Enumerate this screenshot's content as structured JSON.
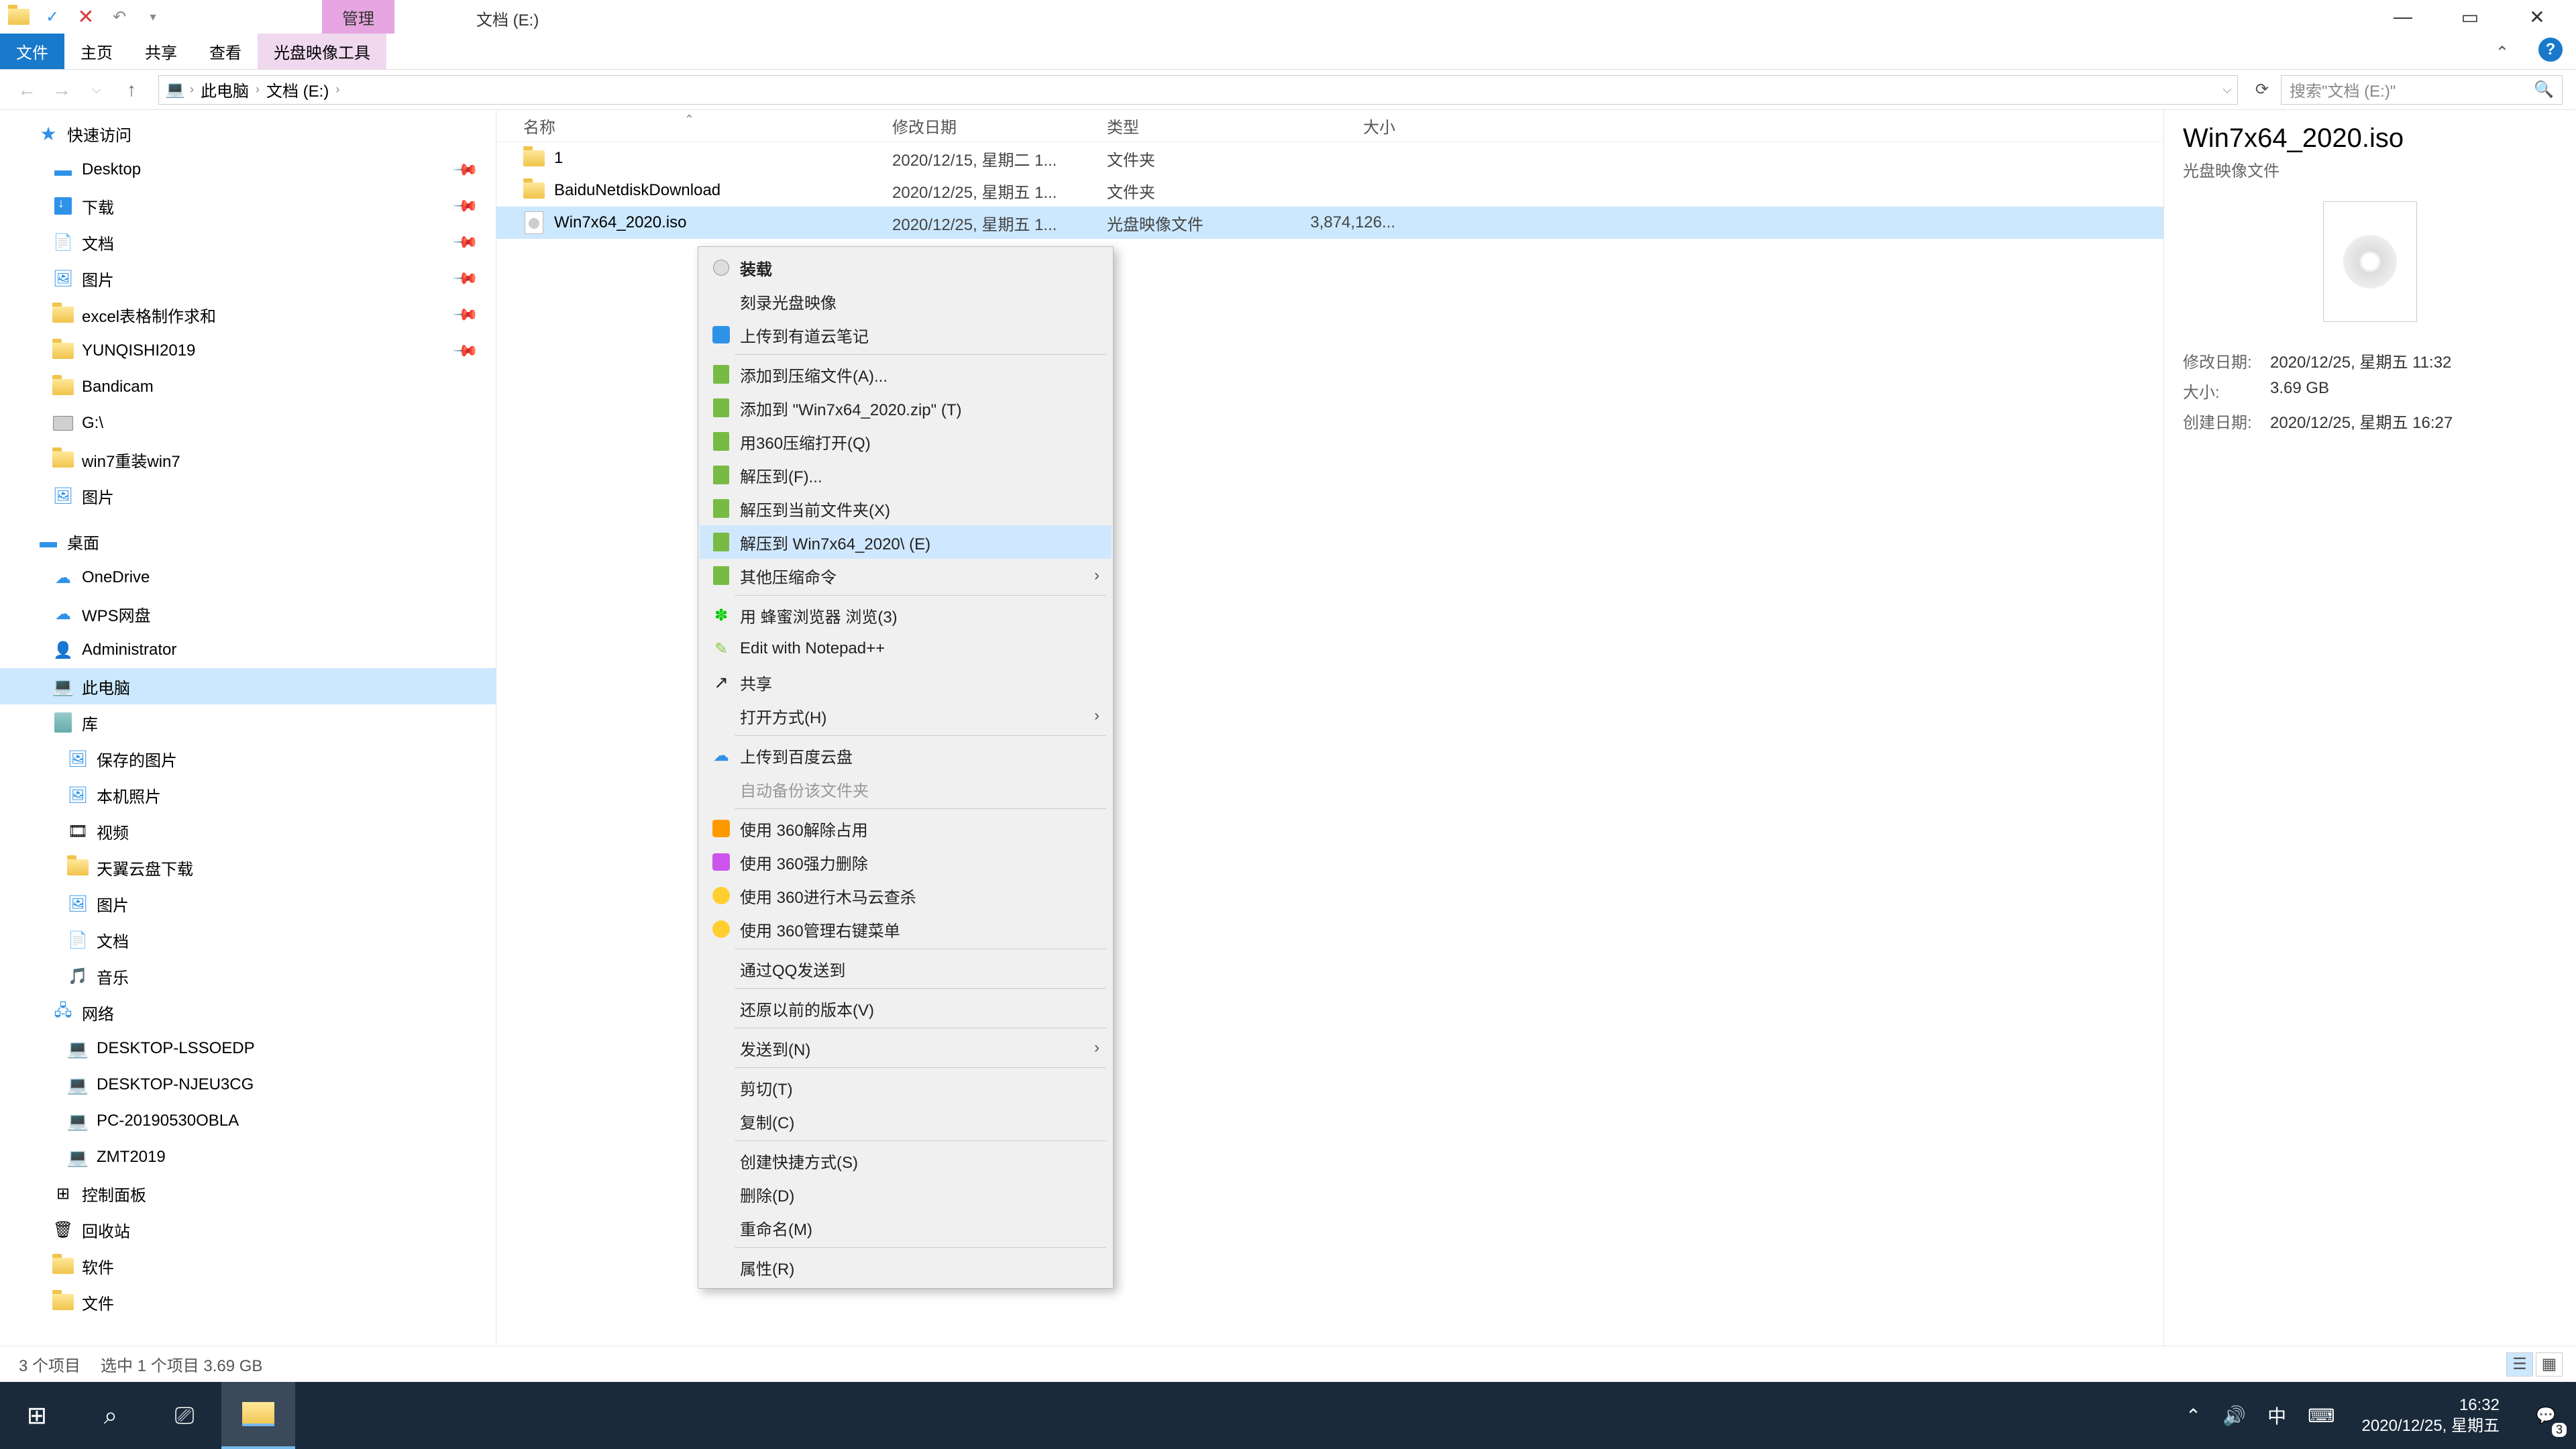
{
  "title": {
    "context": "管理",
    "text": "文档 (E:)"
  },
  "window_controls": {
    "min": "—",
    "max": "▭",
    "close": "✕"
  },
  "ribbon": {
    "file": "文件",
    "home": "主页",
    "share": "共享",
    "view": "查看",
    "tool": "光盘映像工具"
  },
  "address": {
    "crumbs": [
      "此电脑",
      "文档 (E:)"
    ],
    "search_placeholder": "搜索\"文档 (E:)\""
  },
  "tree": {
    "quick": "快速访问",
    "quick_items": [
      "Desktop",
      "下载",
      "文档",
      "图片",
      "excel表格制作求和",
      "YUNQISHI2019",
      "Bandicam",
      "G:\\",
      "win7重装win7",
      "图片"
    ],
    "desktop": "桌面",
    "desktop_items": [
      "OneDrive",
      "WPS网盘",
      "Administrator",
      "此电脑",
      "库"
    ],
    "lib_items": [
      "保存的图片",
      "本机照片",
      "视频",
      "天翼云盘下载",
      "图片",
      "文档",
      "音乐"
    ],
    "network": "网络",
    "net_items": [
      "DESKTOP-LSSOEDP",
      "DESKTOP-NJEU3CG",
      "PC-20190530OBLA",
      "ZMT2019"
    ],
    "cpl": "控制面板",
    "recycle": "回收站",
    "soft": "软件",
    "files": "文件"
  },
  "columns": {
    "name": "名称",
    "date": "修改日期",
    "type": "类型",
    "size": "大小"
  },
  "rows": [
    {
      "name": "1",
      "date": "2020/12/15, 星期二 1...",
      "type": "文件夹",
      "size": ""
    },
    {
      "name": "BaiduNetdiskDownload",
      "date": "2020/12/25, 星期五 1...",
      "type": "文件夹",
      "size": ""
    },
    {
      "name": "Win7x64_2020.iso",
      "date": "2020/12/25, 星期五 1...",
      "type": "光盘映像文件",
      "size": "3,874,126..."
    }
  ],
  "context": [
    {
      "t": "装载",
      "icon": "mount",
      "bold": true
    },
    {
      "t": "刻录光盘映像"
    },
    {
      "t": "上传到有道云笔记",
      "icon": "note"
    },
    {
      "sep": true
    },
    {
      "t": "添加到压缩文件(A)...",
      "icon": "rar"
    },
    {
      "t": "添加到 \"Win7x64_2020.zip\" (T)",
      "icon": "rar"
    },
    {
      "t": "用360压缩打开(Q)",
      "icon": "rar"
    },
    {
      "t": "解压到(F)...",
      "icon": "rar"
    },
    {
      "t": "解压到当前文件夹(X)",
      "icon": "rar"
    },
    {
      "t": "解压到 Win7x64_2020\\ (E)",
      "icon": "rar",
      "hov": true
    },
    {
      "t": "其他压缩命令",
      "icon": "rar",
      "sub": true
    },
    {
      "sep": true
    },
    {
      "t": "用 蜂蜜浏览器 浏览(3)",
      "icon": "bee"
    },
    {
      "t": "Edit with Notepad++",
      "icon": "npp"
    },
    {
      "t": "共享",
      "icon": "share"
    },
    {
      "t": "打开方式(H)",
      "sub": true
    },
    {
      "sep": true
    },
    {
      "t": "上传到百度云盘",
      "icon": "baidu"
    },
    {
      "t": "自动备份该文件夹",
      "dis": true
    },
    {
      "sep": true
    },
    {
      "t": "使用 360解除占用",
      "icon": "360a"
    },
    {
      "t": "使用 360强力删除",
      "icon": "360b"
    },
    {
      "t": "使用 360进行木马云查杀",
      "icon": "360"
    },
    {
      "t": "使用 360管理右键菜单",
      "icon": "360"
    },
    {
      "sep": true
    },
    {
      "t": "通过QQ发送到"
    },
    {
      "sep": true
    },
    {
      "t": "还原以前的版本(V)"
    },
    {
      "sep": true
    },
    {
      "t": "发送到(N)",
      "sub": true
    },
    {
      "sep": true
    },
    {
      "t": "剪切(T)"
    },
    {
      "t": "复制(C)"
    },
    {
      "sep": true
    },
    {
      "t": "创建快捷方式(S)"
    },
    {
      "t": "删除(D)"
    },
    {
      "t": "重命名(M)"
    },
    {
      "sep": true
    },
    {
      "t": "属性(R)"
    }
  ],
  "preview": {
    "title": "Win7x64_2020.iso",
    "subtitle": "光盘映像文件",
    "meta": [
      {
        "l": "修改日期:",
        "v": "2020/12/25, 星期五 11:32"
      },
      {
        "l": "大小:",
        "v": "3.69 GB"
      },
      {
        "l": "创建日期:",
        "v": "2020/12/25, 星期五 16:27"
      }
    ]
  },
  "status": {
    "count": "3 个项目",
    "sel": "选中 1 个项目  3.69 GB"
  },
  "taskbar": {
    "time": "16:32",
    "date": "2020/12/25, 星期五",
    "ime": "中",
    "notif": "3"
  }
}
